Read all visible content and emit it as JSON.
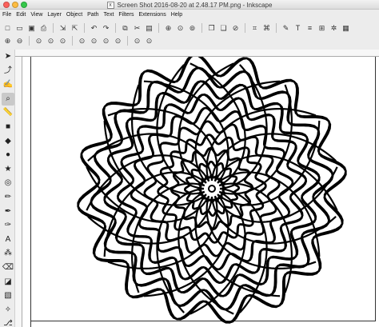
{
  "window": {
    "title": "Screen Shot 2016-08-20 at 2.48.17 PM.png - Inkscape",
    "traffic_colors": [
      "#fc605b",
      "#fdbc40",
      "#34c84a"
    ]
  },
  "menu": [
    "File",
    "Edit",
    "View",
    "Layer",
    "Object",
    "Path",
    "Text",
    "Filters",
    "Extensions",
    "Help"
  ],
  "toolbar1": [
    {
      "icon": "new-document-icon",
      "glyph": "□"
    },
    {
      "icon": "open-icon",
      "glyph": "▭"
    },
    {
      "icon": "save-icon",
      "glyph": "▣"
    },
    {
      "icon": "print-icon",
      "glyph": "⎙"
    },
    {
      "sep": true
    },
    {
      "icon": "import-icon",
      "glyph": "⇲"
    },
    {
      "icon": "export-icon",
      "glyph": "⇱"
    },
    {
      "sep": true
    },
    {
      "icon": "undo-icon",
      "glyph": "↶"
    },
    {
      "icon": "redo-icon",
      "glyph": "↷"
    },
    {
      "sep": true
    },
    {
      "icon": "copy-icon",
      "glyph": "⧉"
    },
    {
      "icon": "cut-icon",
      "glyph": "✂"
    },
    {
      "icon": "paste-icon",
      "glyph": "▤"
    },
    {
      "sep": true
    },
    {
      "icon": "zoom-selection-icon",
      "glyph": "⊕"
    },
    {
      "icon": "zoom-drawing-icon",
      "glyph": "⊙"
    },
    {
      "icon": "zoom-page-icon",
      "glyph": "⊚"
    },
    {
      "sep": true
    },
    {
      "icon": "duplicate-icon",
      "glyph": "❐"
    },
    {
      "icon": "clone-icon",
      "glyph": "❏"
    },
    {
      "icon": "unlink-clone-icon",
      "glyph": "⊘"
    },
    {
      "sep": true
    },
    {
      "icon": "group-icon",
      "glyph": "⌗"
    },
    {
      "icon": "ungroup-icon",
      "glyph": "⌘"
    },
    {
      "sep": true
    },
    {
      "icon": "fill-stroke-icon",
      "glyph": "✎"
    },
    {
      "icon": "text-font-icon",
      "glyph": "T"
    },
    {
      "icon": "xml-editor-icon",
      "glyph": "≡"
    },
    {
      "icon": "align-distribute-icon",
      "glyph": "⊞"
    },
    {
      "icon": "preferences-icon",
      "glyph": "✲"
    },
    {
      "icon": "document-properties-icon",
      "glyph": "▦"
    }
  ],
  "toolbar2": [
    {
      "icon": "zoom-in-icon",
      "glyph": "⊕"
    },
    {
      "icon": "zoom-out-icon",
      "glyph": "⊖"
    },
    {
      "sep": true
    },
    {
      "icon": "zoom-1-1-icon",
      "glyph": "⊙"
    },
    {
      "icon": "zoom-1-2-icon",
      "glyph": "⊙"
    },
    {
      "icon": "zoom-2-1-icon",
      "glyph": "⊙"
    },
    {
      "sep": true
    },
    {
      "icon": "zoom-fit-selection-icon",
      "glyph": "⊙"
    },
    {
      "icon": "zoom-fit-drawing-icon",
      "glyph": "⊙"
    },
    {
      "icon": "zoom-fit-page-icon",
      "glyph": "⊙"
    },
    {
      "icon": "zoom-fit-width-icon",
      "glyph": "⊙"
    },
    {
      "sep": true
    },
    {
      "icon": "zoom-previous-icon",
      "glyph": "⊙"
    },
    {
      "icon": "zoom-next-icon",
      "glyph": "⊙"
    }
  ],
  "tools": [
    {
      "icon": "selector-tool-icon",
      "glyph": "➤"
    },
    {
      "icon": "node-tool-icon",
      "glyph": "⤴"
    },
    {
      "icon": "tweak-tool-icon",
      "glyph": "✍"
    },
    {
      "icon": "zoom-tool-icon",
      "glyph": "⌕",
      "active": true
    },
    {
      "icon": "measure-tool-icon",
      "glyph": "📏"
    },
    {
      "icon": "rectangle-tool-icon",
      "glyph": "■"
    },
    {
      "icon": "3d-box-tool-icon",
      "glyph": "◆"
    },
    {
      "icon": "ellipse-tool-icon",
      "glyph": "●"
    },
    {
      "icon": "star-tool-icon",
      "glyph": "★"
    },
    {
      "icon": "spiral-tool-icon",
      "glyph": "◎"
    },
    {
      "icon": "pencil-tool-icon",
      "glyph": "✏"
    },
    {
      "icon": "pen-tool-icon",
      "glyph": "✒"
    },
    {
      "icon": "calligraphy-tool-icon",
      "glyph": "✑"
    },
    {
      "icon": "text-tool-icon",
      "glyph": "A"
    },
    {
      "icon": "spray-tool-icon",
      "glyph": "⁂"
    },
    {
      "icon": "eraser-tool-icon",
      "glyph": "⌫"
    },
    {
      "icon": "paint-bucket-tool-icon",
      "glyph": "◪"
    },
    {
      "icon": "gradient-tool-icon",
      "glyph": "▧"
    },
    {
      "icon": "dropper-tool-icon",
      "glyph": "✧"
    },
    {
      "icon": "connector-tool-icon",
      "glyph": "⎇"
    }
  ],
  "drawing": {
    "petals": 16,
    "rings": 10,
    "stroke": "#000000"
  }
}
